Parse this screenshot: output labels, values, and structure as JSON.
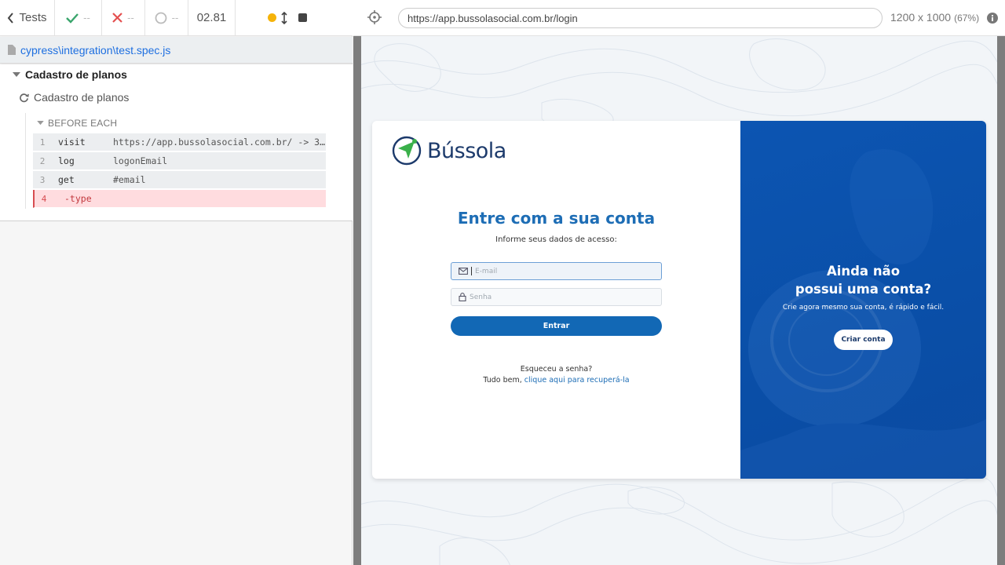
{
  "reporter": {
    "tests_label": "Tests",
    "passed": "--",
    "failed": "--",
    "pending": "--",
    "duration": "02.81",
    "spec_path": "cypress\\integration\\test.spec.js",
    "suite_title": "Cadastro de planos",
    "test_title": "Cadastro de planos",
    "hook_title": "BEFORE EACH",
    "commands": [
      {
        "num": "1",
        "name": "visit",
        "message": "https://app.bussolasocial.com.br/ -> 3…"
      },
      {
        "num": "2",
        "name": "log",
        "message": "logonEmail"
      },
      {
        "num": "3",
        "name": "get",
        "message": "#email"
      },
      {
        "num": "4",
        "name": "-type",
        "message": ""
      }
    ]
  },
  "aut": {
    "url": "https://app.bussolasocial.com.br/login",
    "viewport": "1200 x 1000",
    "scale": "(67%)"
  },
  "app": {
    "logo_text": "Bússola",
    "title": "Entre com a sua conta",
    "subtitle": "Informe seus dados de acesso:",
    "email_placeholder": "E-mail",
    "password_placeholder": "Senha",
    "enter_button": "Entrar",
    "forgot_question": "Esqueceu a senha?",
    "forgot_prefix": "Tudo bem,",
    "forgot_link": "clique aqui para recuperá-la",
    "signup_title_line1": "Ainda não",
    "signup_title_line2": "possui uma conta?",
    "signup_subtitle": "Crie agora mesmo sua conta, é rápido e fácil.",
    "signup_button": "Criar conta"
  },
  "colors": {
    "accent_blue": "#1268b5",
    "panel_blue": "#0c55b2",
    "error_bg": "#ffdcdf",
    "pending_dot": "#f5b30a"
  }
}
